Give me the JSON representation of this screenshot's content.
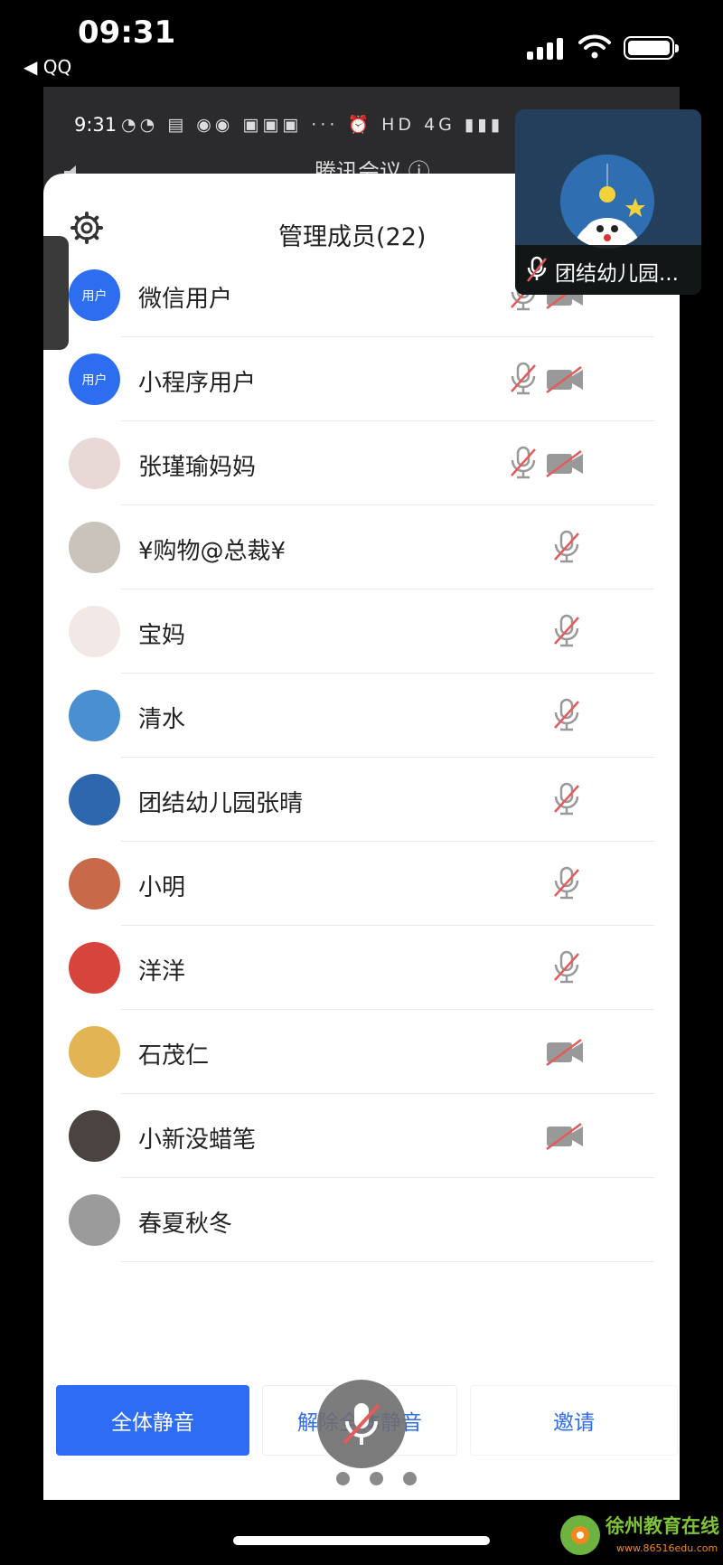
{
  "ios_status": {
    "time": "09:31",
    "back_label": "◀ QQ"
  },
  "android_status": {
    "time": "9:31",
    "icons": "◔◔ ▤ ◉◉ ▣▣▣ ··· ⏰ HD 4G ▮▮▮"
  },
  "meeting": {
    "title": "腾讯会议 ⓘ"
  },
  "panel": {
    "title": "管理成员(22)",
    "members": [
      {
        "name": "微信用户",
        "avatar_badge": "用户",
        "avatar_color": "#2d6df0",
        "mic_muted": true,
        "cam_off": true
      },
      {
        "name": "小程序用户",
        "avatar_badge": "用户",
        "avatar_color": "#2d6df0",
        "mic_muted": true,
        "cam_off": true
      },
      {
        "name": "张瑾瑜妈妈",
        "avatar_badge": "",
        "avatar_color": "#e9d9d6",
        "mic_muted": true,
        "cam_off": true
      },
      {
        "name": "¥购物@总裁¥",
        "avatar_badge": "",
        "avatar_color": "#c9c3bb",
        "mic_muted": true,
        "cam_off": false
      },
      {
        "name": "宝妈",
        "avatar_badge": "",
        "avatar_color": "#f2e9e7",
        "mic_muted": true,
        "cam_off": false
      },
      {
        "name": "清水",
        "avatar_badge": "",
        "avatar_color": "#4a8fd1",
        "mic_muted": true,
        "cam_off": false
      },
      {
        "name": "团结幼儿园张晴",
        "avatar_badge": "",
        "avatar_color": "#2e67ad",
        "mic_muted": true,
        "cam_off": false
      },
      {
        "name": "小明",
        "avatar_badge": "",
        "avatar_color": "#c86a4a",
        "mic_muted": true,
        "cam_off": false
      },
      {
        "name": "洋洋",
        "avatar_badge": "",
        "avatar_color": "#d6443c",
        "mic_muted": true,
        "cam_off": false
      },
      {
        "name": "石茂仁",
        "avatar_badge": "",
        "avatar_color": "#e2b453",
        "mic_muted": false,
        "cam_off": true
      },
      {
        "name": "小新没蜡笔",
        "avatar_badge": "",
        "avatar_color": "#4b4340",
        "mic_muted": false,
        "cam_off": true
      },
      {
        "name": "春夏秋冬",
        "avatar_badge": "",
        "avatar_color": "#9b9b9b",
        "mic_muted": false,
        "cam_off": false
      }
    ],
    "actions": {
      "mute_all": "全体静音",
      "unmute_all": "解除全体静音",
      "invite": "邀请"
    }
  },
  "video_window": {
    "name": "团结幼儿园..."
  },
  "watermark": {
    "text": "徐州教育在线",
    "url": "www.86516edu.com"
  },
  "colors": {
    "accent": "#2e6cf6",
    "muted_icon": "#999999",
    "mute_slash": "#e45b5b"
  }
}
